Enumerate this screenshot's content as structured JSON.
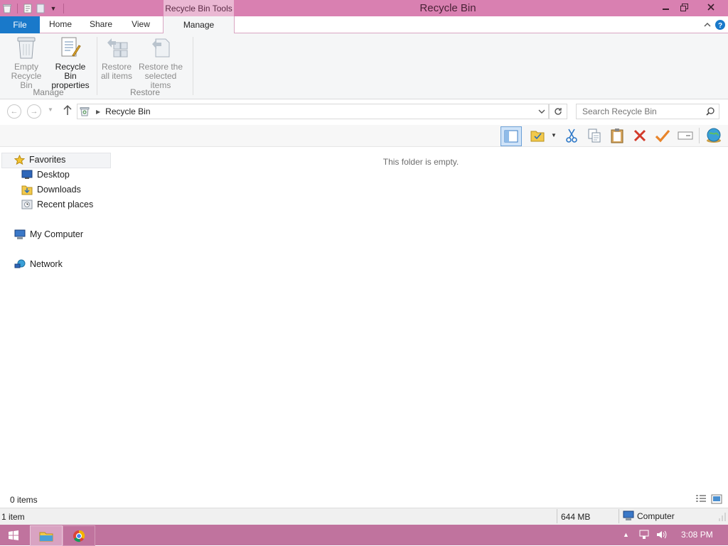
{
  "window": {
    "title": "Recycle Bin",
    "context_tab": "Recycle Bin Tools"
  },
  "ribbon": {
    "tabs": [
      "File",
      "Home",
      "Share",
      "View",
      "Manage"
    ],
    "groups": {
      "manage": "Manage",
      "restore": "Restore"
    },
    "buttons": {
      "empty_line1": "Empty",
      "empty_line2": "Recycle Bin",
      "props_line1": "Recycle Bin",
      "props_line2": "properties",
      "restore_all_line1": "Restore",
      "restore_all_line2": "all items",
      "restore_sel_line1": "Restore the",
      "restore_sel_line2": "selected items"
    }
  },
  "address": {
    "path": "Recycle Bin",
    "search_placeholder": "Search Recycle Bin"
  },
  "nav": {
    "favorites": "Favorites",
    "items": [
      "Desktop",
      "Downloads",
      "Recent places"
    ],
    "my_computer": "My Computer",
    "network": "Network"
  },
  "content": {
    "empty_message": "This folder is empty."
  },
  "status": {
    "items": "0 items",
    "selection": "1 item",
    "size": "644 MB",
    "location": "Computer"
  },
  "taskbar": {
    "clock": "3:08 PM"
  },
  "colors": {
    "title": "#d980b1",
    "file_tab": "#1979ca",
    "taskbar": "#c0739e"
  }
}
